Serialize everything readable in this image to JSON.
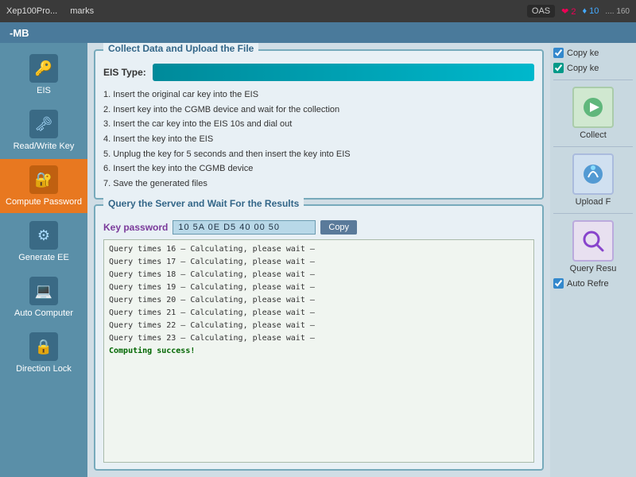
{
  "topbar": {
    "left_tabs": [
      "Xep100Pro...",
      "marks"
    ],
    "oas": "OAS",
    "hearts": "❤ 2",
    "diamonds": "♦ 10",
    "signal": ".... 160"
  },
  "titlebar": {
    "title": "-MB"
  },
  "sidebar": {
    "items": [
      {
        "id": "eis",
        "label": "EIS",
        "icon": "🔑"
      },
      {
        "id": "read-write-key",
        "label": "Read/Write Key",
        "icon": "🗝"
      },
      {
        "id": "compute-password",
        "label": "Compute Password",
        "icon": "🔐",
        "active": true
      },
      {
        "id": "generate-ee",
        "label": "Generate EE",
        "icon": "⚙"
      },
      {
        "id": "auto-computer",
        "label": "Auto Computer",
        "icon": "💻"
      },
      {
        "id": "direction-lock",
        "label": "Direction Lock",
        "icon": "🔒"
      }
    ]
  },
  "collect_section": {
    "title": "Collect Data and Upload the File",
    "eis_label": "EIS Type:",
    "steps": [
      "1. Insert the original car key into the EIS",
      "2. Insert key into the CGMB device and wait for the collection",
      "3. Insert the car key into the EIS 10s and dial out",
      "4. Insert the key into the EIS",
      "5. Unplug the key for 5 seconds and then insert the key into EIS",
      "6. Insert the key into the CGMB device",
      "7. Save the generated files"
    ]
  },
  "query_section": {
    "title": "Query the Server and Wait For the Results",
    "key_password_label": "Key password",
    "key_password_value": "10 5A 0E D5 40 00 50",
    "copy_label": "Copy",
    "log_lines": [
      "Query times 16 — Calculating, please wait —",
      "Query times 17 — Calculating, please wait —",
      "Query times 18 — Calculating, please wait —",
      "Query times 19 — Calculating, please wait —",
      "Query times 20 — Calculating, please wait —",
      "Query times 21 — Calculating, please wait —",
      "Query times 22 — Calculating, please wait —",
      "Query times 23 — Calculating, please wait —"
    ],
    "success_msg": "Computing success!"
  },
  "right_panel": {
    "copy_key1_label": "Copy ke",
    "copy_key2_label": "Copy ke",
    "collect_label": "Collect",
    "upload_label": "Upload F",
    "query_label": "Query Resu",
    "auto_refresh_label": "Auto Refre"
  }
}
